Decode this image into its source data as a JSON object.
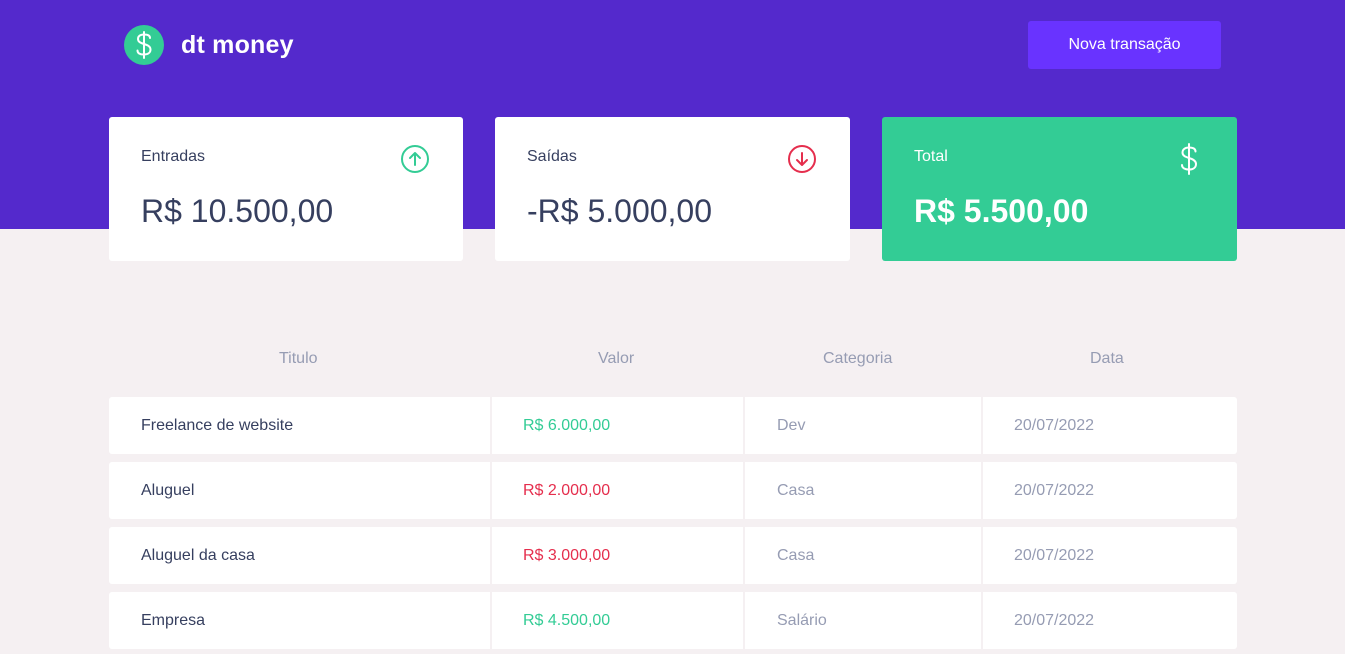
{
  "app": {
    "logo_text": "dt money",
    "new_transaction_label": "Nova transação"
  },
  "summary": {
    "income": {
      "label": "Entradas",
      "value": "R$ 10.500,00",
      "icon": "arrow-up-circle-icon"
    },
    "outcome": {
      "label": "Saídas",
      "value": "-R$ 5.000,00",
      "icon": "arrow-down-circle-icon"
    },
    "total": {
      "label": "Total",
      "value": "R$ 5.500,00",
      "icon": "dollar-icon"
    }
  },
  "table": {
    "headers": [
      "Titulo",
      "Valor",
      "Categoria",
      "Data"
    ],
    "rows": [
      {
        "title": "Freelance de website",
        "value": "R$ 6.000,00",
        "type": "deposit",
        "category": "Dev",
        "date": "20/07/2022"
      },
      {
        "title": "Aluguel",
        "value": "R$ 2.000,00",
        "type": "withdraw",
        "category": "Casa",
        "date": "20/07/2022"
      },
      {
        "title": "Aluguel da casa",
        "value": "R$ 3.000,00",
        "type": "withdraw",
        "category": "Casa",
        "date": "20/07/2022"
      },
      {
        "title": "Empresa",
        "value": "R$ 4.500,00",
        "type": "deposit",
        "category": "Salário",
        "date": "20/07/2022"
      }
    ]
  },
  "colors": {
    "header_bg": "#5429cc",
    "button_bg": "#6933ff",
    "green": "#33cc95",
    "red": "#e52e4d",
    "text_title": "#363f5f",
    "text_body": "#969cb3",
    "page_bg": "#f5f0f2"
  }
}
